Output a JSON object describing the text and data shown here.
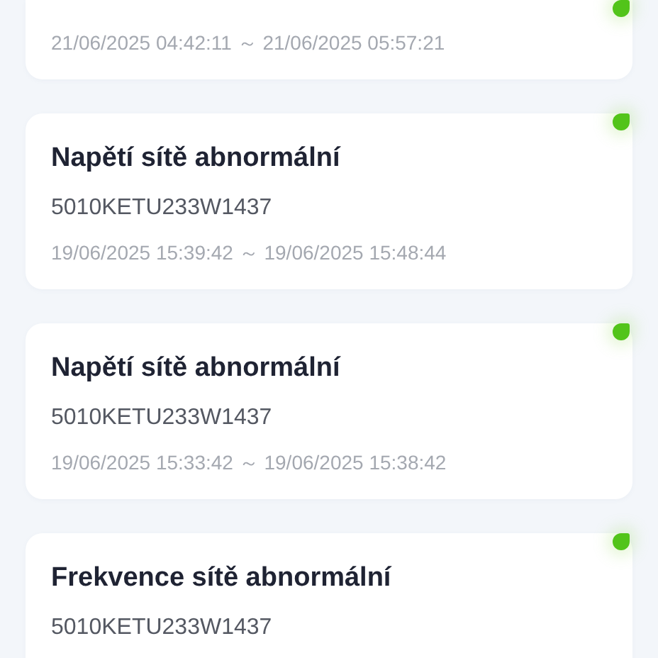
{
  "alarms": [
    {
      "time_range": "21/06/2025 04:42:11 ～ 21/06/2025 05:57:21",
      "color": "#52c41a"
    },
    {
      "title": "Napětí sítě abnormální",
      "device": "5010KETU233W1437",
      "time_range": "19/06/2025 15:39:42 ～ 19/06/2025 15:48:44",
      "color": "#52c41a"
    },
    {
      "title": "Napětí sítě abnormální",
      "device": "5010KETU233W1437",
      "time_range": "19/06/2025 15:33:42 ～ 19/06/2025 15:38:42",
      "color": "#52c41a"
    },
    {
      "title": "Frekvence sítě abnormální",
      "device": "5010KETU233W1437",
      "color": "#52c41a"
    }
  ]
}
